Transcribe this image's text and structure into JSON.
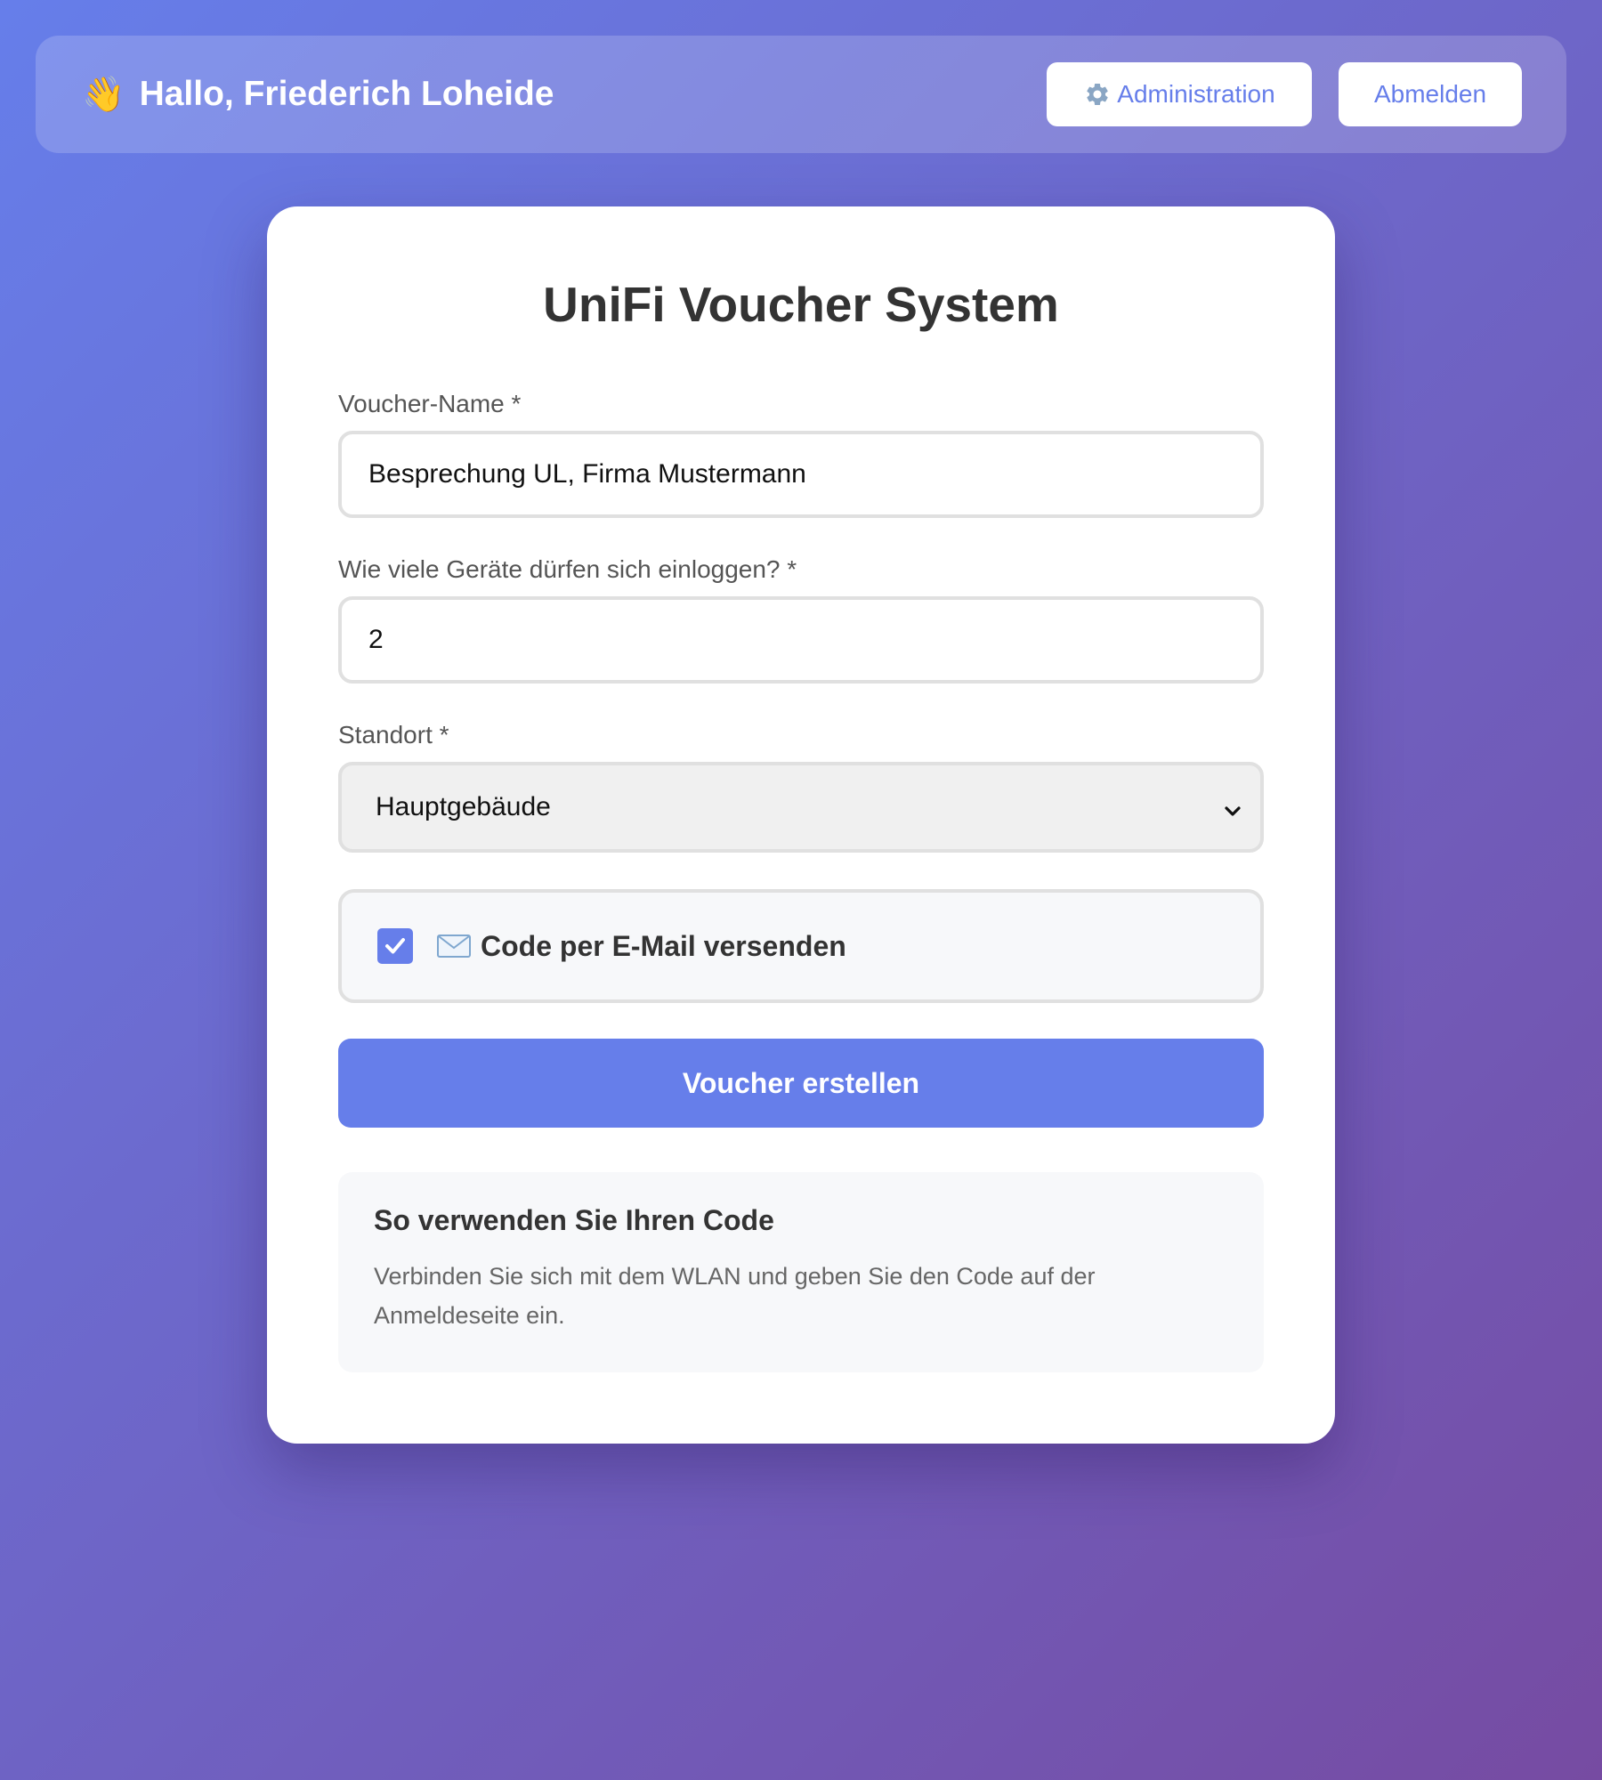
{
  "header": {
    "greeting": "Hallo, Friederich Loheide",
    "greeting_icon": "👋",
    "admin_label": "Administration",
    "logout_label": "Abmelden"
  },
  "card": {
    "title": "UniFi Voucher System"
  },
  "form": {
    "voucher_name_label": "Voucher-Name *",
    "voucher_name_value": "Besprechung UL, Firma Mustermann",
    "devices_label": "Wie viele Geräte dürfen sich einloggen? *",
    "devices_value": "2",
    "location_label": "Standort *",
    "location_value": "Hauptgebäude",
    "email_checkbox_label": "Code per E-Mail versenden",
    "email_checkbox_checked": true,
    "submit_label": "Voucher erstellen"
  },
  "info": {
    "title": "So verwenden Sie Ihren Code",
    "text": "Verbinden Sie sich mit dem WLAN und geben Sie den Code auf der Anmeldeseite ein."
  },
  "colors": {
    "accent": "#667eea",
    "gradient_start": "#667eea",
    "gradient_end": "#764ba2"
  },
  "icons": {
    "greeting": "waving-hand-icon",
    "admin": "gear-icon",
    "checkbox": "checkmark-icon",
    "email": "envelope-icon",
    "select": "chevron-down-icon"
  }
}
